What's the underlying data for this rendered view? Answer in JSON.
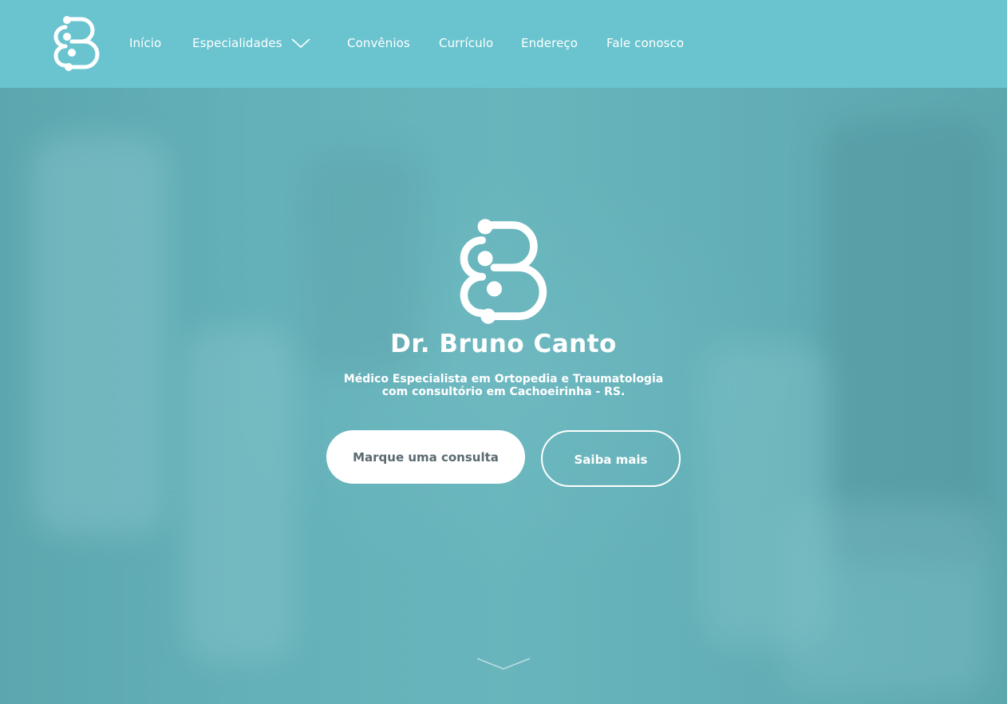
{
  "nav": {
    "logo_icon": "cb-monogram-logo",
    "items": [
      {
        "label": "Início"
      },
      {
        "label": "Especialidades"
      },
      {
        "label": "Convênios"
      },
      {
        "label": "Currículo"
      },
      {
        "label": "Endereço"
      },
      {
        "label": "Fale conosco"
      }
    ],
    "dropdown_icon": "chevron-down-icon"
  },
  "hero": {
    "logo_icon": "cb-monogram-logo",
    "title": "Dr. Bruno Canto",
    "subtitle": "Médico Especialista em Ortopedia e Traumatologia com consultório em Cachoeirinha - RS.",
    "primary_button": "Marque uma consulta",
    "secondary_button": "Saiba mais",
    "scroll_icon": "chevron-down-icon"
  },
  "colors": {
    "navbar": "#6ac4cf",
    "hero_tint": "#63adb5",
    "text": "#ffffff",
    "primary_button_text": "#5a6a70"
  }
}
